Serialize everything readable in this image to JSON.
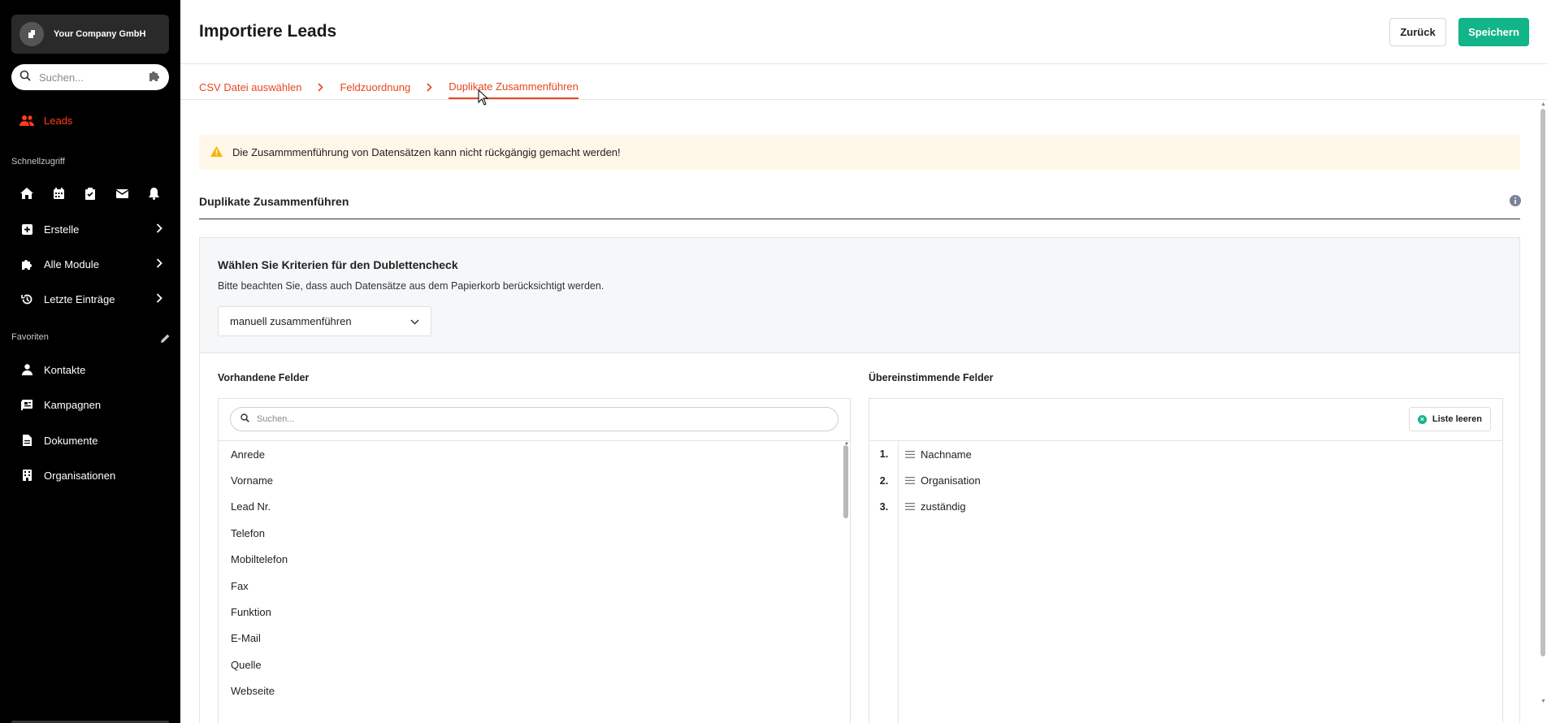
{
  "sidebar": {
    "company": "Your Company GmbH",
    "search_placeholder": "Suchen...",
    "active_item": "Leads",
    "quick_access_label": "Schnellzugriff",
    "quick_icons": [
      "home-icon",
      "calendar-icon",
      "clipboard-check-icon",
      "mail-icon",
      "bell-icon"
    ],
    "menu": [
      {
        "label": "Erstelle",
        "icon": "plus-square-icon"
      },
      {
        "label": "Alle Module",
        "icon": "puzzle-icon"
      },
      {
        "label": "Letzte Einträge",
        "icon": "history-icon"
      }
    ],
    "favorites_label": "Favoriten",
    "favorites": [
      {
        "label": "Kontakte",
        "icon": "person-icon"
      },
      {
        "label": "Kampagnen",
        "icon": "campaign-icon"
      },
      {
        "label": "Dokumente",
        "icon": "document-icon"
      },
      {
        "label": "Organisationen",
        "icon": "building-icon"
      }
    ]
  },
  "header": {
    "title": "Importiere Leads",
    "back_label": "Zurück",
    "save_label": "Speichern"
  },
  "steps": [
    "CSV Datei auswählen",
    "Feldzuordnung",
    "Duplikate Zusammenführen"
  ],
  "alert": {
    "text": "Die Zusammmenführung von Datensätzen kann nicht rückgängig gemacht werden!"
  },
  "section": {
    "title": "Duplikate Zusammenführen"
  },
  "criteria": {
    "title": "Wählen Sie Kriterien für den Dublettencheck",
    "subtitle": "Bitte beachten Sie, dass auch Datensätze aus dem Papierkorb berücksichtigt werden.",
    "select_value": "manuell zusammenführen"
  },
  "available": {
    "label": "Vorhandene Felder",
    "search_placeholder": "Suchen...",
    "items": [
      "Anrede",
      "Vorname",
      "Lead Nr.",
      "Telefon",
      "Mobiltelefon",
      "Fax",
      "Funktion",
      "E-Mail",
      "Quelle",
      "Webseite"
    ]
  },
  "matching": {
    "label": "Übereinstimmende Felder",
    "clear_label": "Liste leeren",
    "items": [
      {
        "num": "1.",
        "label": "Nachname"
      },
      {
        "num": "2.",
        "label": "Organisation"
      },
      {
        "num": "3.",
        "label": "zuständig"
      }
    ]
  },
  "colors": {
    "accent": "#e8471b",
    "save": "#12b48a",
    "sidebar_bg": "#000000",
    "alert_bg": "#fff7e8",
    "warning": "#f5b400"
  }
}
